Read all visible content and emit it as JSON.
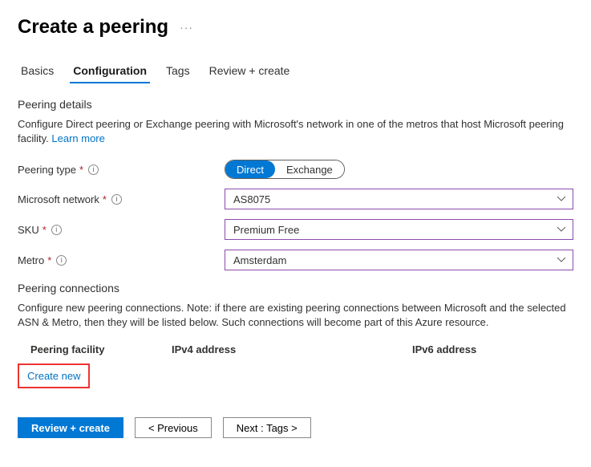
{
  "header": {
    "title": "Create a peering"
  },
  "tabs": [
    {
      "label": "Basics",
      "active": false
    },
    {
      "label": "Configuration",
      "active": true
    },
    {
      "label": "Tags",
      "active": false
    },
    {
      "label": "Review + create",
      "active": false
    }
  ],
  "details": {
    "heading": "Peering details",
    "desc_a": "Configure Direct peering or Exchange peering with Microsoft's network in one of the metros that host Microsoft peering facility. ",
    "learn_more": "Learn more"
  },
  "fields": {
    "peering_type": {
      "label": "Peering type",
      "options": [
        "Direct",
        "Exchange"
      ],
      "selected": "Direct"
    },
    "ms_network": {
      "label": "Microsoft network",
      "value": "AS8075"
    },
    "sku": {
      "label": "SKU",
      "value": "Premium Free"
    },
    "metro": {
      "label": "Metro",
      "value": "Amsterdam"
    }
  },
  "connections": {
    "heading": "Peering connections",
    "desc": "Configure new peering connections. Note: if there are existing peering connections between Microsoft and the selected ASN & Metro, then they will be listed below. Such connections will become part of this Azure resource.",
    "columns": [
      "Peering facility",
      "IPv4 address",
      "IPv6 address"
    ],
    "create_new": "Create new"
  },
  "footer": {
    "review": "Review + create",
    "previous": "< Previous",
    "next": "Next : Tags >"
  }
}
